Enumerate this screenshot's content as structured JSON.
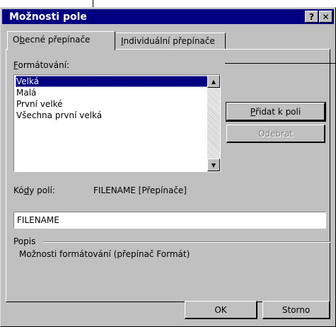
{
  "dialog": {
    "title": "Možnosti pole",
    "help_glyph": "?",
    "close_glyph": "✕"
  },
  "tabs": [
    {
      "label_pre": "O",
      "label_key": "b",
      "label_post": "ecné přepínače",
      "active": true
    },
    {
      "label_pre": "",
      "label_key": "I",
      "label_post": "ndividuální přepínače",
      "active": false
    }
  ],
  "formatting": {
    "label_key": "F",
    "label_post": "ormátování:",
    "items": [
      "Velká",
      "Malá",
      "První velké",
      "Všechna první velká"
    ],
    "selected_index": 0
  },
  "buttons": {
    "add_pre": "",
    "add_key": "P",
    "add_post": "řidat k poli",
    "remove": "Odebrat",
    "ok": "OK",
    "cancel": "Storno"
  },
  "field_codes": {
    "label_pre": "Kó",
    "label_key": "d",
    "label_post": "y polí:",
    "value": "FILENAME [Přepínače]"
  },
  "field_input": {
    "value": "FILENAME"
  },
  "description": {
    "group_label": "Popis",
    "text": "Možnosti formátování (přepínač Formát)"
  }
}
